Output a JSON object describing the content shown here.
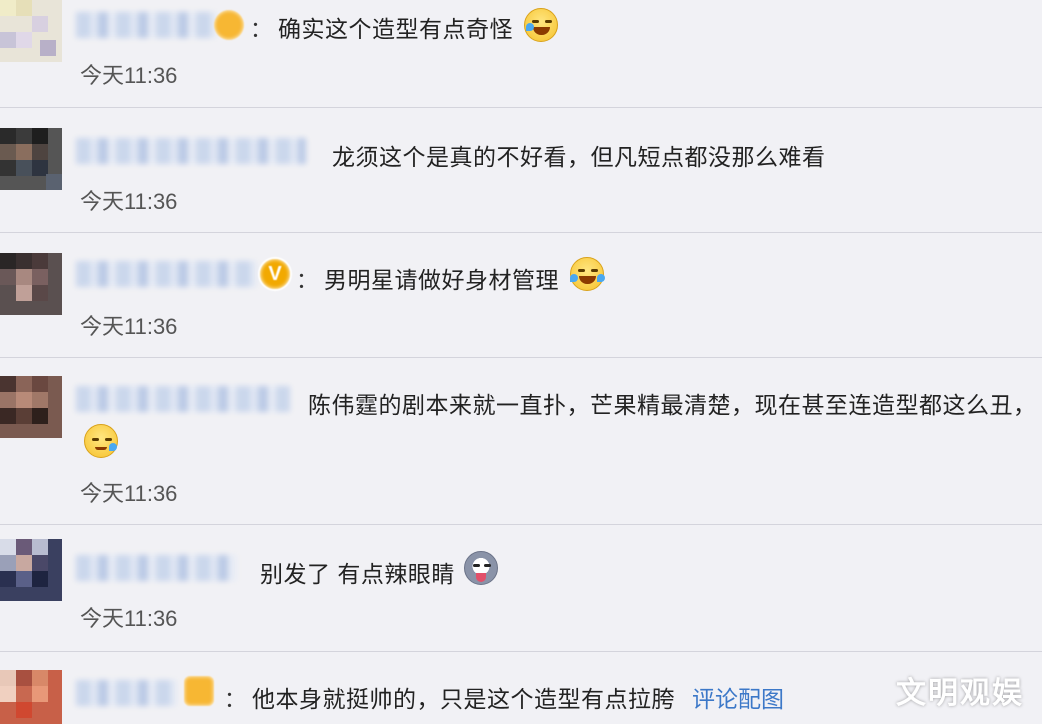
{
  "comments": [
    {
      "text": "确实这个造型有点奇怪",
      "time": "今天11:36",
      "emoji": "laugh-cry-emoji"
    },
    {
      "text": "龙须这个是真的不好看，但凡短点都没那么难看",
      "time": "今天11:36"
    },
    {
      "text": "男明星请做好身材管理",
      "time": "今天11:36",
      "emoji": "laugh-tears-emoji"
    },
    {
      "text": "陈伟霆的剧本来就一直扑，芒果精最清楚，现在甚至连造型都这么丑，",
      "time": "今天11:36",
      "emoji": "sweat-emoji"
    },
    {
      "text": "别发了 有点辣眼睛",
      "time": "今天11:36",
      "emoji": "husky-emoji"
    },
    {
      "text": "他本身就挺帅的，只是这个造型有点拉胯",
      "link": "评论配图"
    }
  ],
  "colon": "：",
  "verified_mark": "V",
  "watermark": "文明观娱",
  "colors": {
    "background": "#f1f1f5",
    "link": "#3c78c8",
    "badge": "#f7b733"
  }
}
